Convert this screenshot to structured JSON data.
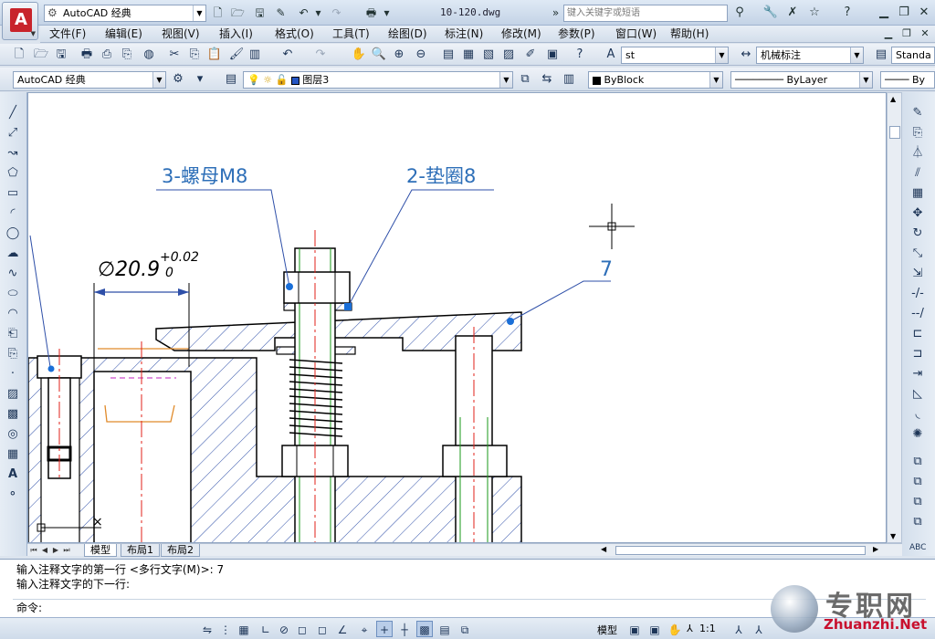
{
  "app": {
    "workspace": "AutoCAD 经典",
    "document_title": "10-120.dwg",
    "search_placeholder": "键入关键字或短语"
  },
  "menu": [
    "文件(F)",
    "编辑(E)",
    "视图(V)",
    "插入(I)",
    "格式(O)",
    "工具(T)",
    "绘图(D)",
    "标注(N)",
    "修改(M)",
    "参数(P)",
    "窗口(W)",
    "帮助(H)"
  ],
  "toolbar": {
    "workspace_combo": "AutoCAD 经典",
    "layer_combo": "图层3",
    "text_style": "st",
    "dim_style": "机械标注",
    "table_style": "Standa",
    "color_combo": "ByBlock",
    "linetype_combo": "ByLayer",
    "lineweight_combo": "By"
  },
  "drawing": {
    "label_nut": "3-螺母M8",
    "label_washer": "2-垫圈8",
    "label_plate": "7",
    "dim_main": "∅20.9",
    "dim_upper": "+0.02",
    "dim_lower": "0"
  },
  "tabs": [
    "模型",
    "布局1",
    "布局2"
  ],
  "command": {
    "history": [
      "输入注释文字的第一行 <多行文字(M)>: 7",
      "输入注释文字的下一行:"
    ],
    "prompt": "命令:"
  },
  "status": {
    "space": "模型",
    "scale": "1:1"
  },
  "watermark": {
    "cn": "专职网",
    "en": "Zhuanzhi.Net"
  }
}
